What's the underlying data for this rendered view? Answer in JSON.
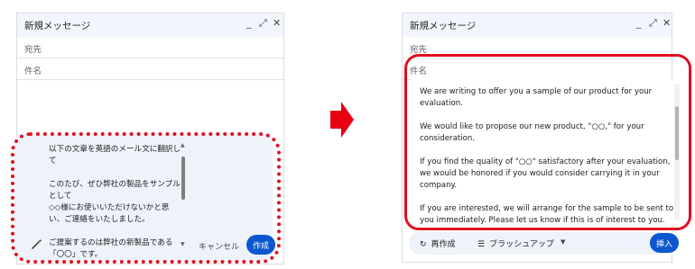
{
  "left_window": {
    "title": "新規メッセージ",
    "to_label": "宛先",
    "subject_label": "件名",
    "prompt_paragraphs": [
      "以下の文章を英語のメール文に翻訳して",
      "このたび、ぜひ弊社の製品をサンプルとして\n◇◇様にお使いいただけないかと思い、ご連絡をいたしました。",
      "ご提案するのは弊社の新製品である「〇〇」です。"
    ],
    "cancel_label": "キャンセル",
    "create_label": "作成"
  },
  "right_window": {
    "title": "新規メッセージ",
    "to_label": "宛先",
    "subject_label": "件名",
    "result_paragraphs": [
      "We are writing to offer you a sample of our product for your evaluation.",
      "We would like to propose our new product, \"○○,\" for your consideration.",
      "If you find the quality of \"○○\" satisfactory after your evaluation, we would be honored if you would consider carrying it in your company.",
      "If you are interested, we will arrange for the sample to be sent to you immediately. Please let us know if this is of interest to you."
    ],
    "regenerate_label": "再作成",
    "brushup_label": "ブラッシュアップ",
    "insert_label": "挿入"
  },
  "window_controls": {
    "minimize": "_",
    "expand": "⤢",
    "close": "✕"
  },
  "colors": {
    "highlight_red": "#e0101f",
    "primary_blue": "#0b57d0",
    "panel_bg": "#eef2f9"
  },
  "icons": {
    "arrow": "right-arrow-icon",
    "pencil": "pencil-sparkle-icon",
    "regenerate": "refresh-icon",
    "brushup": "brush-lines-icon",
    "dropdown": "caret-down-icon"
  }
}
